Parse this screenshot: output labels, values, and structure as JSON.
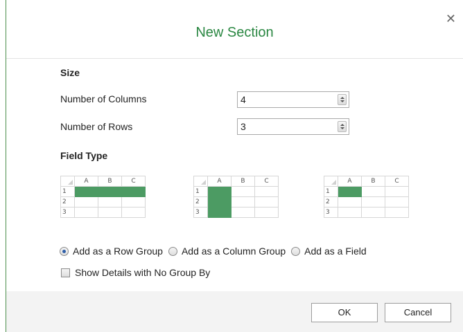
{
  "dialog": {
    "title": "New Section",
    "close_icon": "close-icon"
  },
  "size": {
    "heading": "Size",
    "columns_label": "Number of Columns",
    "columns_value": "4",
    "rows_label": "Number of Rows",
    "rows_value": "3"
  },
  "field_type": {
    "heading": "Field Type",
    "preview_headers": [
      "A",
      "B",
      "C"
    ],
    "preview_rows": [
      "1",
      "2",
      "3"
    ],
    "fill_color": "#4c9b63"
  },
  "options": {
    "row_group": "Add as a Row Group",
    "column_group": "Add as a Column Group",
    "field": "Add as a Field",
    "selected": "row_group",
    "show_details": "Show Details with No Group By",
    "show_details_checked": false
  },
  "footer": {
    "ok": "OK",
    "cancel": "Cancel"
  },
  "colors": {
    "title": "#2a8742",
    "accent_border": "#4c8f4c"
  }
}
